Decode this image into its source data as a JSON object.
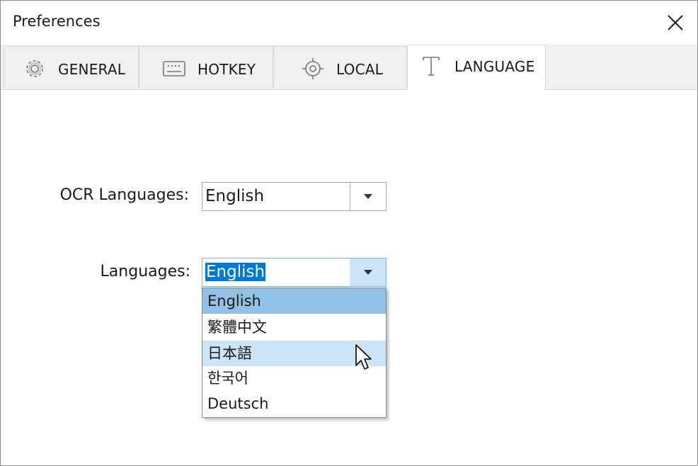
{
  "window": {
    "title": "Preferences"
  },
  "tabs": [
    {
      "label": "GENERAL",
      "icon": "gear-icon"
    },
    {
      "label": "HOTKEY",
      "icon": "keyboard-icon"
    },
    {
      "label": "LOCAL",
      "icon": "target-icon"
    },
    {
      "label": "LANGUAGE",
      "icon": "text-t-icon",
      "active": true
    }
  ],
  "ocr": {
    "label": "OCR Languages:",
    "value": "English"
  },
  "languages": {
    "label": "Languages:",
    "value": "English",
    "options": [
      "English",
      "繁體中文",
      "日本語",
      "한국어",
      "Deutsch"
    ],
    "selected_index": 0,
    "hover_index": 2
  },
  "colors": {
    "selected": "#91c1e5",
    "hover": "#cce4f7",
    "highlight": "#0078d7"
  }
}
